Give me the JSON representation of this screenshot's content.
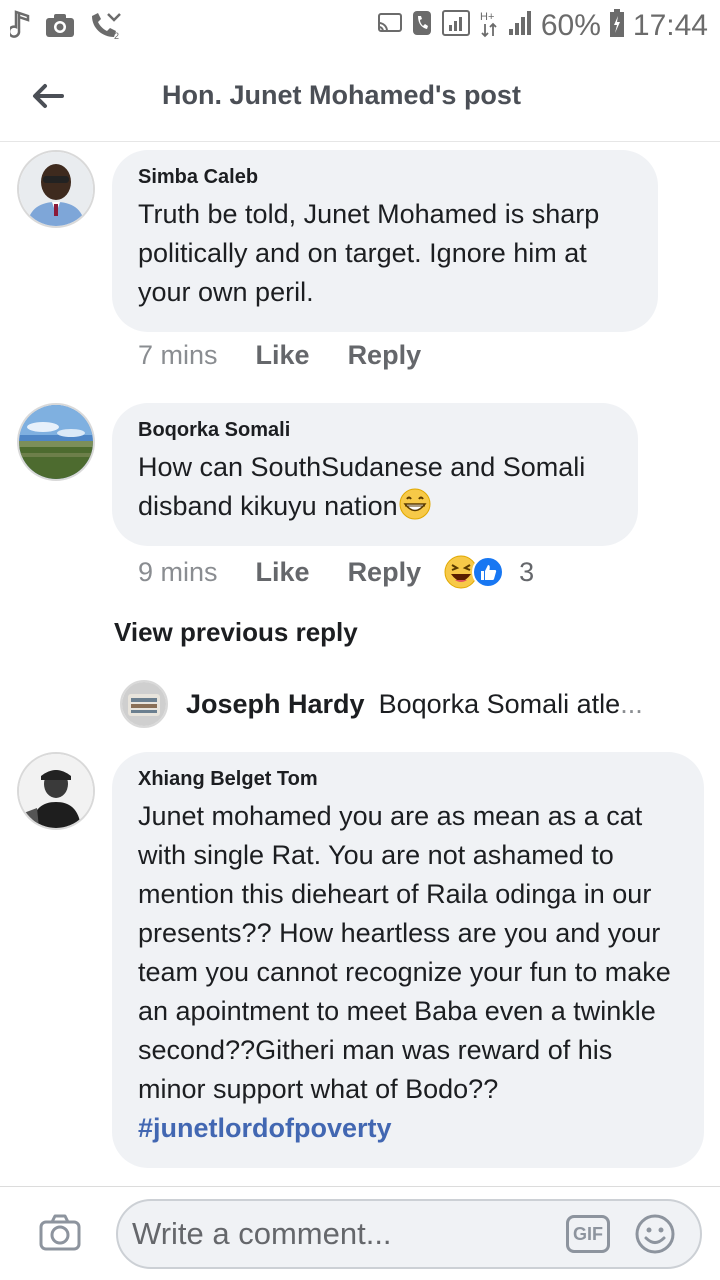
{
  "status_bar": {
    "battery_percent": "60%",
    "time": "17:44",
    "left_icons": [
      "music-note-icon",
      "camera-icon",
      "missed-call-icon"
    ],
    "right_icons": [
      "cast-icon",
      "phone-signal-icon",
      "wifi-calling-icon",
      "hplus-icon",
      "signal-bars-icon",
      "battery-icon"
    ]
  },
  "header": {
    "title": "Hon. Junet Mohamed's post"
  },
  "comments": [
    {
      "author": "Simba Caleb",
      "text": "Truth be told, Junet Mohamed is sharp politically and on target. Ignore him at your own peril.",
      "time": "7 mins",
      "like_label": "Like",
      "reply_label": "Reply"
    },
    {
      "author": "Boqorka Somali",
      "text": "How can SouthSudanese and Somali disband kikuyu nation",
      "emoji": "😁",
      "time": "9 mins",
      "like_label": "Like",
      "reply_label": "Reply",
      "reaction_count": "3",
      "reactions": [
        "haha-icon",
        "like-icon"
      ]
    },
    {
      "author": "Xhiang Belget Tom",
      "text": "Junet mohamed you are as mean as a cat with single Rat. You are not ashamed to mention this dieheart of Raila odinga in our presents?? How heartless are you and your team you cannot recognize your fun to make an apointment to meet Baba even a twinkle second??Githeri man was reward of his minor support what of Bodo??",
      "hashtag": "#junetlordofpoverty"
    }
  ],
  "replies": {
    "view_previous_label": "View previous reply",
    "preview_author": "Joseph Hardy",
    "preview_text": "Boqorka Somali atle",
    "preview_ellipsis": "..."
  },
  "composer": {
    "placeholder": "Write a comment...",
    "gif_label": "GIF"
  },
  "colors": {
    "bubble": "#f0f2f5",
    "hashtag": "#4267b2",
    "text": "#1c1e21",
    "meta": "#65676b"
  }
}
